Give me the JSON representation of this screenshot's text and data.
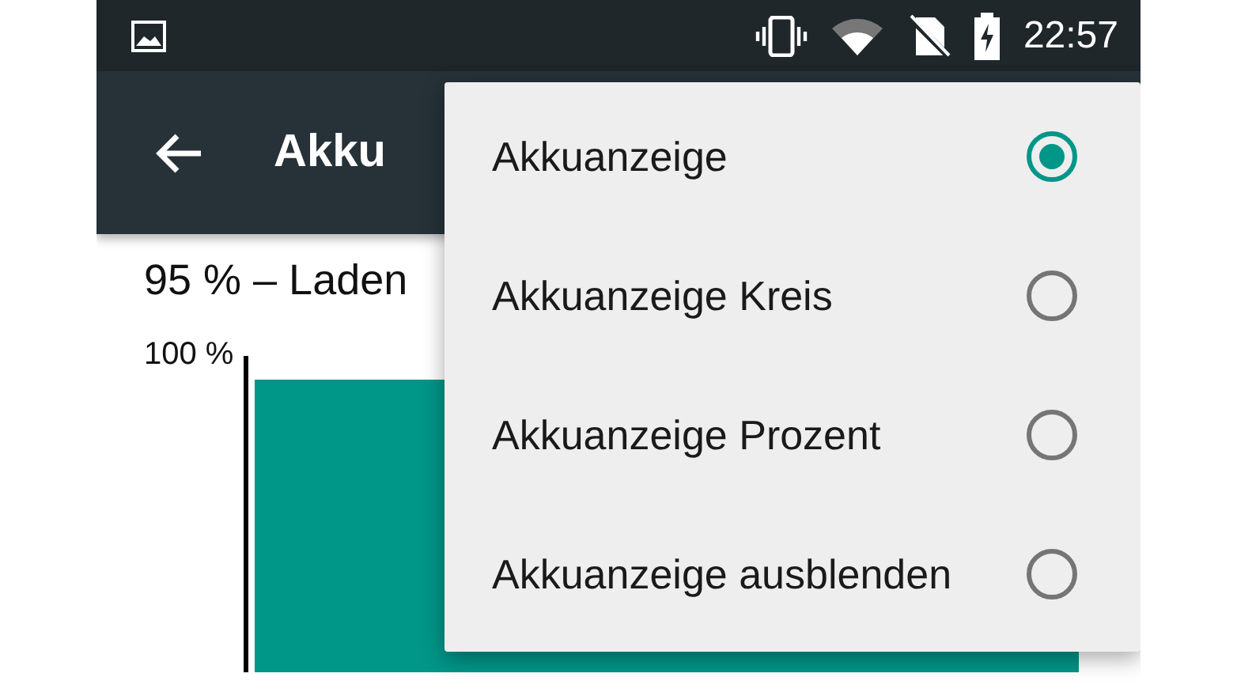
{
  "status_bar": {
    "time": "22:57"
  },
  "toolbar": {
    "title": "Akku"
  },
  "battery_status": "95 % – Laden",
  "chart": {
    "y_label": "100 %"
  },
  "menu": [
    {
      "label": "Akkuanzeige",
      "selected": true
    },
    {
      "label": "Akkuanzeige Kreis",
      "selected": false
    },
    {
      "label": "Akkuanzeige Prozent",
      "selected": false
    },
    {
      "label": "Akkuanzeige ausblenden",
      "selected": false
    }
  ]
}
